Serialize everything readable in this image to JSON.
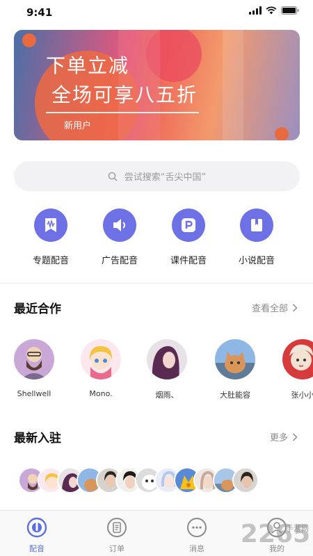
{
  "status_bar": {
    "time": "9:41"
  },
  "banner": {
    "line1": "下单立减",
    "line2": "全场可享八五折",
    "tag": "新用户"
  },
  "search": {
    "placeholder": "尝试搜索“舌尖中国”"
  },
  "categories": [
    {
      "label": "专题配音",
      "icon": "bookmark-wave-icon"
    },
    {
      "label": "广告配音",
      "icon": "speaker-icon"
    },
    {
      "label": "课件配音",
      "icon": "p-badge-icon"
    },
    {
      "label": "小说配音",
      "icon": "book-icon"
    }
  ],
  "recent": {
    "title": "最近合作",
    "more": "查看全部",
    "partners": [
      {
        "name": "Shellwell"
      },
      {
        "name": "Mono."
      },
      {
        "name": "烟雨、"
      },
      {
        "name": "大肚能容"
      },
      {
        "name": "张小小"
      }
    ]
  },
  "newcomers": {
    "title": "最新入驻",
    "more": "更多",
    "count": 12
  },
  "tabs": [
    {
      "label": "配音",
      "icon": "dubbing-icon",
      "active": true
    },
    {
      "label": "订单",
      "icon": "order-icon",
      "active": false
    },
    {
      "label": "消息",
      "icon": "message-icon",
      "active": false
    },
    {
      "label": "我的",
      "icon": "profile-icon",
      "active": false
    }
  ],
  "watermark": {
    "text": "2265",
    "sub": "手游网"
  },
  "colors": {
    "accent": "#6e71e6",
    "tab_active": "#5b6fe0",
    "muted": "#8a8a8a"
  }
}
